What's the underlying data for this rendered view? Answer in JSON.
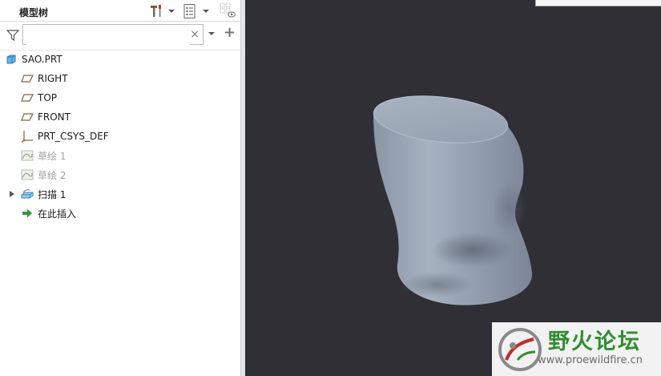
{
  "panel": {
    "tab_title": "模型树",
    "search": {
      "value": "",
      "clear_glyph": "×"
    },
    "toolbar": [
      "settings-tools-icon",
      "dropdown-icon",
      "show-list-icon",
      "dropdown-icon",
      "tree-filter-icon"
    ]
  },
  "tree": {
    "items": [
      {
        "label": "SAO.PRT",
        "icon": "part-icon",
        "dimmed": false
      },
      {
        "label": "RIGHT",
        "icon": "datum-plane-icon",
        "dimmed": false
      },
      {
        "label": "TOP",
        "icon": "datum-plane-icon",
        "dimmed": false
      },
      {
        "label": "FRONT",
        "icon": "datum-plane-icon",
        "dimmed": false
      },
      {
        "label": "PRT_CSYS_DEF",
        "icon": "csys-icon",
        "dimmed": false
      },
      {
        "label": "草绘 1",
        "icon": "sketch-icon",
        "dimmed": true
      },
      {
        "label": "草绘 2",
        "icon": "sketch-icon",
        "dimmed": true
      },
      {
        "label": "扫描 1",
        "icon": "sweep-icon",
        "dimmed": false,
        "expandable": true
      },
      {
        "label": "在此插入",
        "icon": "insert-here-arrow-icon",
        "dimmed": false
      }
    ]
  },
  "watermark": {
    "title": "野火论坛",
    "url": "www.proewildfire.cn"
  },
  "colors": {
    "viewport_bg": "#2f2f35",
    "model_color": "#9aa5b5",
    "watermark_green": "#2f8f2f"
  }
}
